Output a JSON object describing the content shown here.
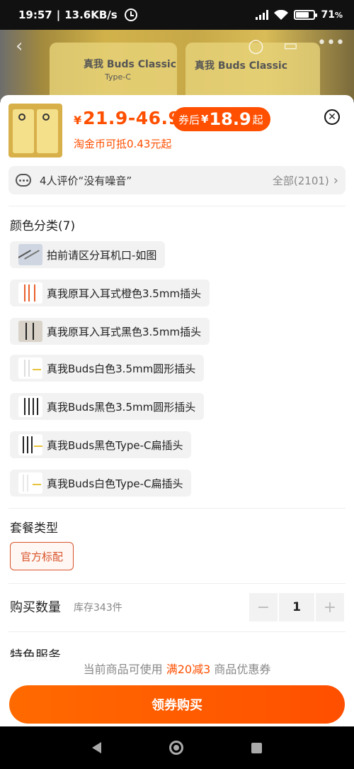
{
  "status_bar": {
    "time": "19:57",
    "net_speed": "13.6KB/s",
    "battery": "71",
    "battery_unit": "%"
  },
  "product": {
    "price_currency": "¥",
    "price_range": "21.9-46.9",
    "coupon_label": "券后",
    "coupon_currency": "¥",
    "coupon_price": "18.9",
    "coupon_suffix": "起",
    "coin_text": "淘金币可抵0.43元起",
    "bg_text_1": "真我 Buds Classic",
    "bg_text_2": "真我 Buds Classic",
    "bg_text_3": "Type-C"
  },
  "reviews": {
    "summary": "4人评价“没有噪音”",
    "all_label": "全部(2101)"
  },
  "color_section": {
    "title": "颜色分类(7)",
    "options": [
      {
        "label": "拍前请区分耳机口-如图"
      },
      {
        "label": "真我原耳入耳式橙色3.5mm插头"
      },
      {
        "label": "真我原耳入耳式黑色3.5mm插头"
      },
      {
        "label": "真我Buds白色3.5mm圆形插头"
      },
      {
        "label": "真我Buds黑色3.5mm圆形插头"
      },
      {
        "label": "真我Buds黑色Type-C扁插头"
      },
      {
        "label": "真我Buds白色Type-C扁插头"
      }
    ]
  },
  "package_section": {
    "title": "套餐类型",
    "selected": "官方标配"
  },
  "quantity": {
    "label": "购买数量",
    "stock": "库存343件",
    "value": "1",
    "minus": "−",
    "plus": "+"
  },
  "special_service": {
    "title": "特色服务"
  },
  "promo": {
    "prefix": "当前商品可使用",
    "highlight": "满20减3",
    "suffix": "商品优惠券"
  },
  "buy_button": {
    "label": "领券购买"
  },
  "colors": {
    "accent": "#ff4f00"
  }
}
